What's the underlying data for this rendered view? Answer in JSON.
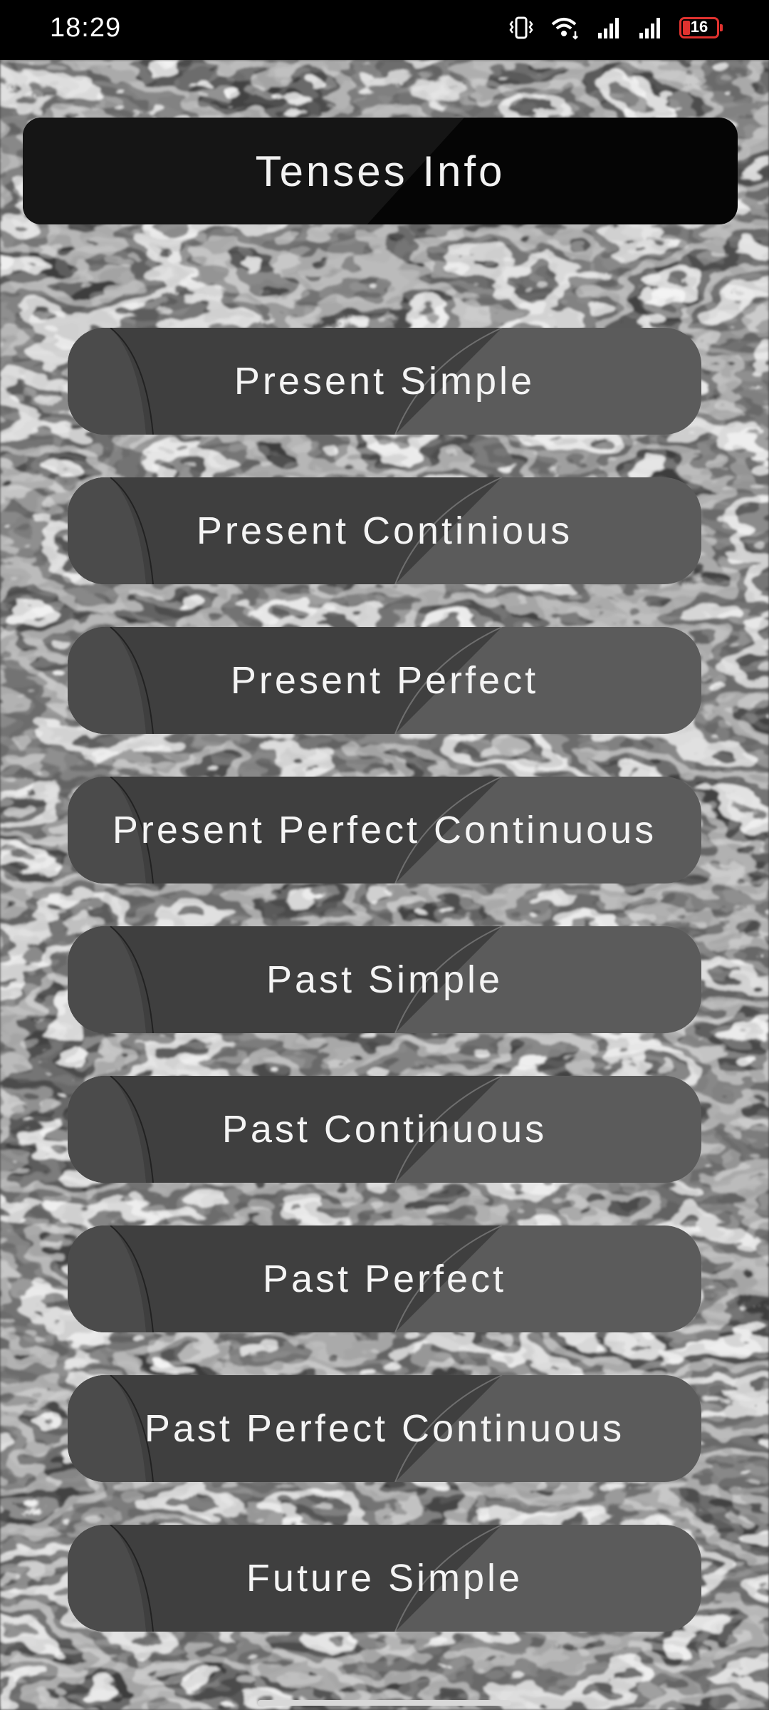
{
  "status_bar": {
    "time": "18:29",
    "battery_level": "16",
    "icons": [
      "vibrate-icon",
      "wifi-icon",
      "signal-icon",
      "signal-icon",
      "battery-icon"
    ]
  },
  "header": {
    "title": "Tenses Info"
  },
  "tenses": [
    {
      "label": "Present Simple"
    },
    {
      "label": "Present Continious"
    },
    {
      "label": "Present Perfect"
    },
    {
      "label": "Present Perfect Continuous"
    },
    {
      "label": "Past Simple"
    },
    {
      "label": "Past Continuous"
    },
    {
      "label": "Past Perfect"
    },
    {
      "label": "Past Perfect Continuous"
    },
    {
      "label": "Future Simple"
    }
  ],
  "colors": {
    "button_base": "#5b5b5b",
    "button_dark": "#3d3d3d",
    "header_bg": "#050505",
    "battery_accent": "#e0322f"
  }
}
